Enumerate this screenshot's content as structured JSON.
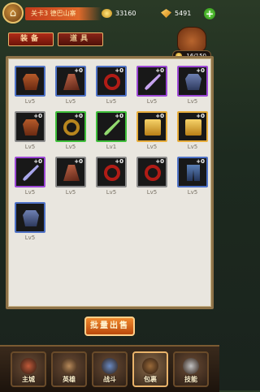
{
  "topbar": {
    "menu_icon": "pagoda-icon",
    "stage_label": "关卡3 德巴山寨",
    "gold": "33160",
    "gems": "5491",
    "plus_label": "+"
  },
  "tabs": [
    {
      "label": "装备"
    },
    {
      "label": "道具"
    }
  ],
  "bag": {
    "capacity": "16/150"
  },
  "items": [
    {
      "icon": "armor-icon",
      "quality": "blue",
      "plus": "",
      "level": "Lv5"
    },
    {
      "icon": "cloak-icon",
      "quality": "blue",
      "plus": "+0",
      "level": "Lv5"
    },
    {
      "icon": "ring-icon",
      "quality": "blue",
      "plus": "+0",
      "level": "Lv5"
    },
    {
      "icon": "blade-icon",
      "quality": "purple",
      "plus": "+0",
      "level": "Lv5"
    },
    {
      "icon": "armor-icon",
      "quality": "purple",
      "plus": "+0",
      "level": "Lv5"
    },
    {
      "icon": "armor-icon",
      "quality": "grey",
      "plus": "+0",
      "level": "Lv5"
    },
    {
      "icon": "ring-icon",
      "quality": "green",
      "plus": "+0",
      "level": "Lv5"
    },
    {
      "icon": "blade-icon",
      "quality": "green",
      "plus": "+0",
      "level": "Lv1"
    },
    {
      "icon": "book-icon",
      "quality": "gold",
      "plus": "+0",
      "level": "Lv5"
    },
    {
      "icon": "book-icon",
      "quality": "gold",
      "plus": "+0",
      "level": "Lv5"
    },
    {
      "icon": "blade-icon",
      "quality": "purple",
      "plus": "+0",
      "level": "Lv5"
    },
    {
      "icon": "cloak-icon",
      "quality": "grey",
      "plus": "+0",
      "level": "Lv5"
    },
    {
      "icon": "ring-icon",
      "quality": "grey",
      "plus": "+0",
      "level": "Lv5"
    },
    {
      "icon": "ring-icon",
      "quality": "grey",
      "plus": "+0",
      "level": "Lv5"
    },
    {
      "icon": "boots-icon",
      "quality": "blue",
      "plus": "+0",
      "level": "Lv5"
    },
    {
      "icon": "armor-icon",
      "quality": "blue",
      "plus": "",
      "level": "Lv5"
    }
  ],
  "sell_button": "批量出售",
  "nav": [
    {
      "label": "主城",
      "icon": "city-icon"
    },
    {
      "label": "英雄",
      "icon": "hero-icon"
    },
    {
      "label": "战斗",
      "icon": "battle-icon"
    },
    {
      "label": "包裹",
      "icon": "bag-icon"
    },
    {
      "label": "技能",
      "icon": "swords-icon"
    }
  ]
}
